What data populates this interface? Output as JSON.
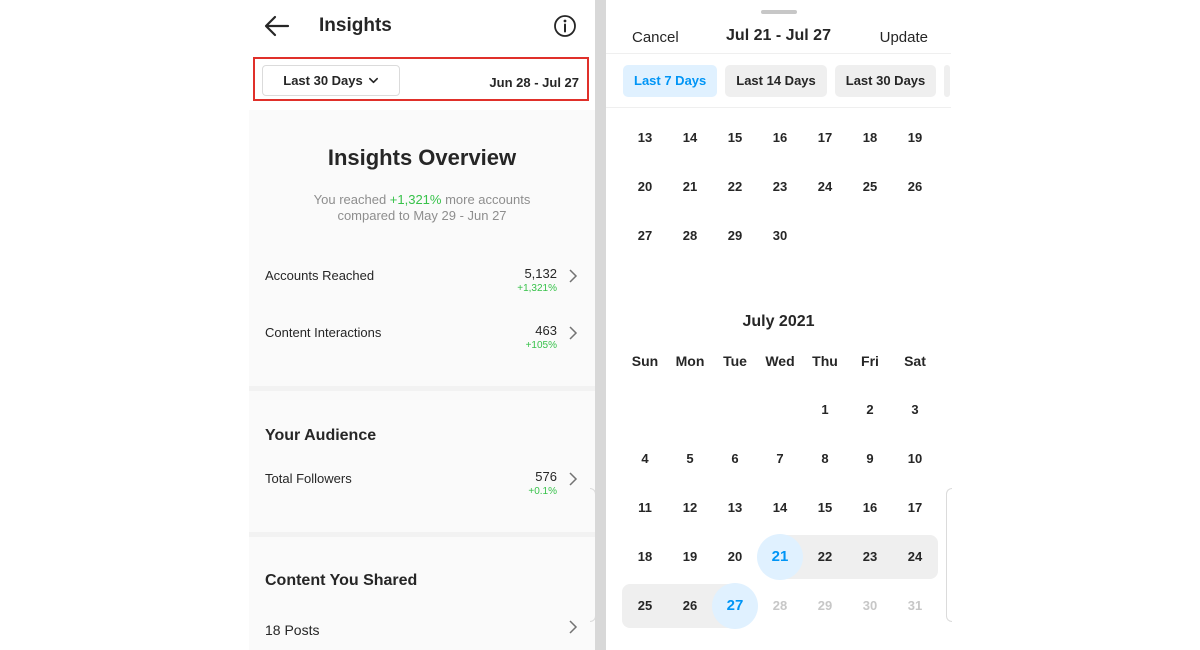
{
  "insights": {
    "title": "Insights",
    "range_button": "Last 30 Days",
    "range_dates": "Jun 28 - Jul 27",
    "overview_title": "Insights Overview",
    "overview_sub_prefix": "You reached ",
    "overview_sub_pct": "+1,321%",
    "overview_sub_suffix": " more accounts compared to May 29 - Jun 27",
    "rows": [
      {
        "label": "Accounts Reached",
        "value": "5,132",
        "change": "+1,321%"
      },
      {
        "label": "Content Interactions",
        "value": "463",
        "change": "+105%"
      }
    ],
    "audience_title": "Your Audience",
    "followers": {
      "label": "Total Followers",
      "value": "576",
      "change": "+0.1%"
    },
    "content_title": "Content You Shared",
    "posts": "18 Posts"
  },
  "picker": {
    "cancel": "Cancel",
    "title": "Jul 21 - Jul 27",
    "update": "Update",
    "presets": [
      {
        "label": "Last 7 Days",
        "active": true
      },
      {
        "label": "Last 14 Days",
        "active": false
      },
      {
        "label": "Last 30 Days",
        "active": false
      }
    ],
    "june_rows": [
      [
        "13",
        "14",
        "15",
        "16",
        "17",
        "18",
        "19"
      ],
      [
        "20",
        "21",
        "22",
        "23",
        "24",
        "25",
        "26"
      ],
      [
        "27",
        "28",
        "29",
        "30"
      ]
    ],
    "month_title": "July 2021",
    "weekdays": [
      "Sun",
      "Mon",
      "Tue",
      "Wed",
      "Thu",
      "Fri",
      "Sat"
    ],
    "july_rows": [
      [
        "",
        "",
        "",
        "",
        "1",
        "2",
        "3"
      ],
      [
        "4",
        "5",
        "6",
        "7",
        "8",
        "9",
        "10"
      ],
      [
        "11",
        "12",
        "13",
        "14",
        "15",
        "16",
        "17"
      ],
      [
        "18",
        "19",
        "20",
        "21",
        "22",
        "23",
        "24"
      ],
      [
        "25",
        "26",
        "27",
        "28",
        "29",
        "30",
        "31"
      ]
    ],
    "range_start": "21",
    "range_end": "27",
    "future_days": [
      "28",
      "29",
      "30",
      "31"
    ],
    "accent_color": "#0095f6"
  }
}
